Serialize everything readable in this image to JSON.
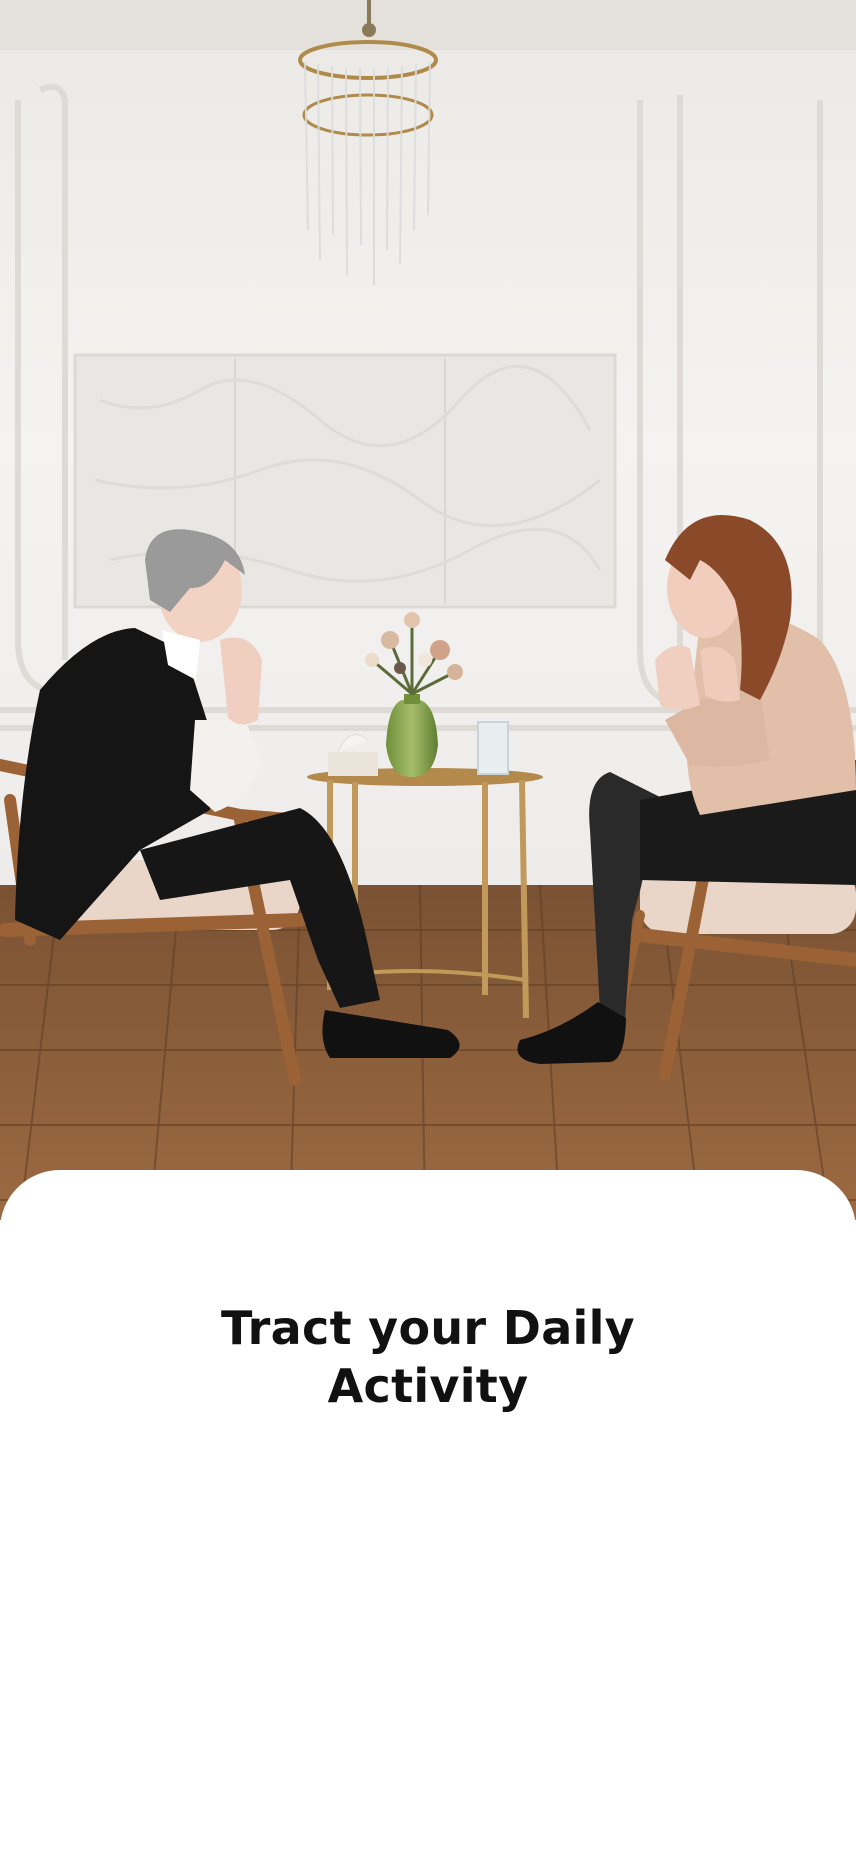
{
  "hero": {
    "icon": "hero-illustration-counseling-session"
  },
  "onboarding": {
    "title_line_1": "Tract your Daily",
    "title_line_2": "Activity"
  },
  "colors": {
    "wall": "#f1f0ee",
    "floor": "#8a5a34",
    "sheet": "#ffffff",
    "title_text": "#111111"
  }
}
